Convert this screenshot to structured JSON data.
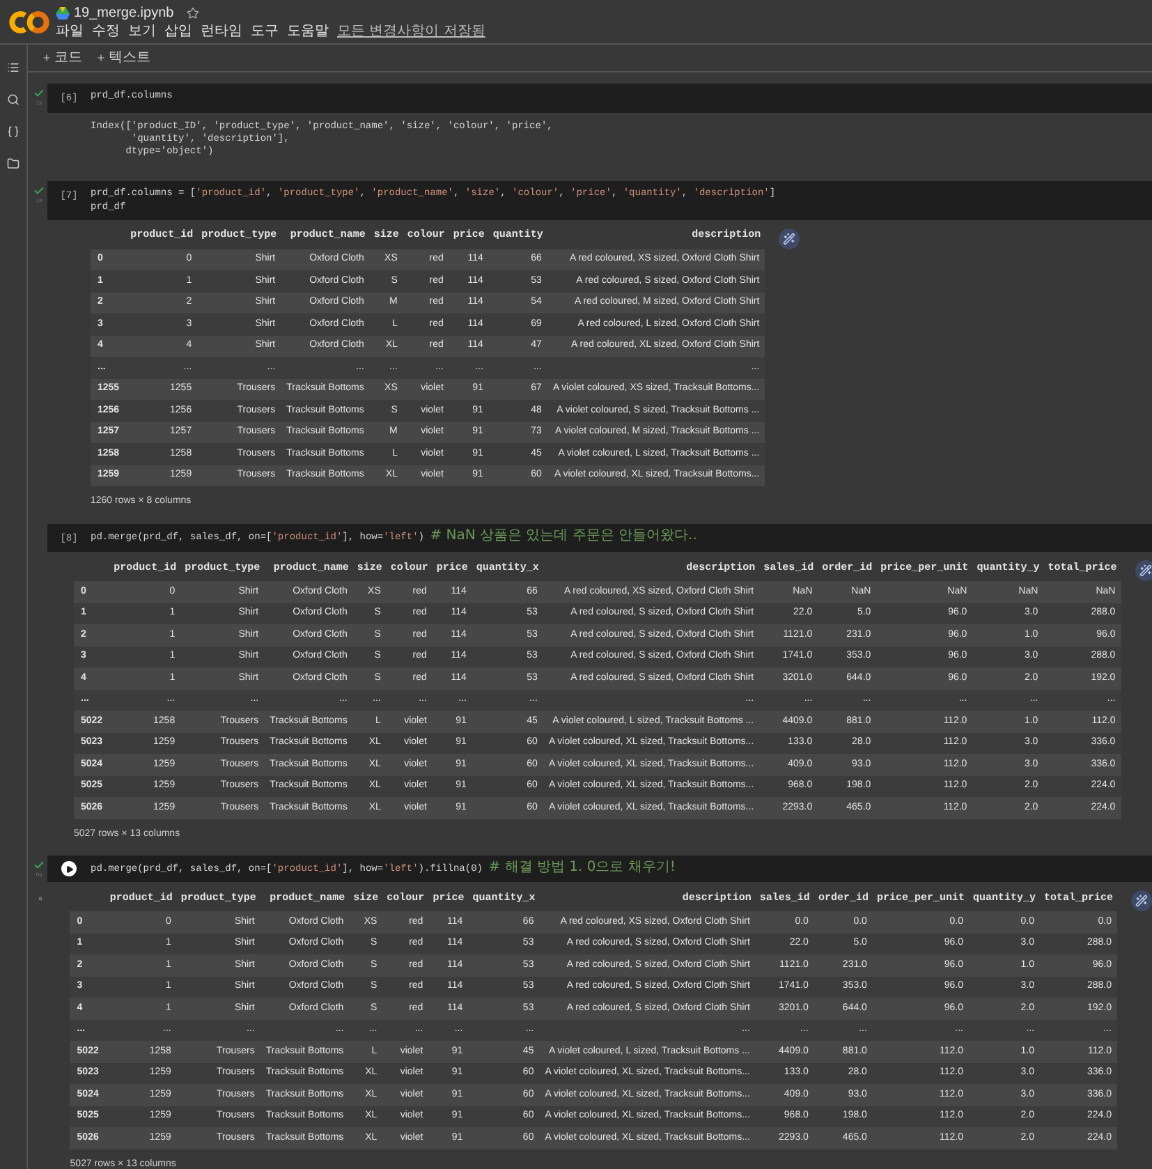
{
  "notebook": {
    "title": "19_merge.ipynb",
    "menu": [
      "파일",
      "수정",
      "보기",
      "삽입",
      "런타임",
      "도구",
      "도움말"
    ],
    "save_status": "모든 변경사항이 저장됨"
  },
  "toolbar": [
    "코드",
    "텍스트"
  ],
  "cells": [
    {
      "count": "[6]",
      "executed": true,
      "time": "1s",
      "focused": false,
      "code": [
        [
          {
            "text": "prd_df.columns",
            "kind": "plain"
          }
        ]
      ],
      "output": {
        "kind": "text",
        "lines": [
          "Index(['product_ID', 'product_type', 'product_name', 'size', 'colour', 'price',",
          "       'quantity', 'description'],",
          "      dtype='object')"
        ]
      }
    },
    {
      "count": "[7]",
      "executed": true,
      "time": "1s",
      "focused": false,
      "code": [
        [
          {
            "text": "prd_df.columns = [",
            "kind": "plain"
          },
          {
            "text": "'product_id'",
            "kind": "string"
          },
          {
            "text": ", ",
            "kind": "plain"
          },
          {
            "text": "'product_type'",
            "kind": "string"
          },
          {
            "text": ", ",
            "kind": "plain"
          },
          {
            "text": "'product_name'",
            "kind": "string"
          },
          {
            "text": ", ",
            "kind": "plain"
          },
          {
            "text": "'size'",
            "kind": "string"
          },
          {
            "text": ", ",
            "kind": "plain"
          },
          {
            "text": "'colour'",
            "kind": "string"
          },
          {
            "text": ", ",
            "kind": "plain"
          },
          {
            "text": "'price'",
            "kind": "string"
          },
          {
            "text": ", ",
            "kind": "plain"
          },
          {
            "text": "'quantity'",
            "kind": "string"
          },
          {
            "text": ", ",
            "kind": "plain"
          },
          {
            "text": "'description'",
            "kind": "string"
          },
          {
            "text": "]",
            "kind": "plain"
          }
        ],
        [
          {
            "text": "prd_df",
            "kind": "plain"
          }
        ]
      ],
      "output": {
        "kind": "table",
        "columns": [
          "",
          "product_id",
          "product_type",
          "product_name",
          "size",
          "colour",
          "price",
          "quantity",
          "description"
        ],
        "rows": [
          [
            "0",
            "0",
            "Shirt",
            "Oxford Cloth",
            "XS",
            "red",
            "114",
            "66",
            "A red coloured, XS sized, Oxford Cloth Shirt"
          ],
          [
            "1",
            "1",
            "Shirt",
            "Oxford Cloth",
            "S",
            "red",
            "114",
            "53",
            "A red coloured, S sized, Oxford Cloth Shirt"
          ],
          [
            "2",
            "2",
            "Shirt",
            "Oxford Cloth",
            "M",
            "red",
            "114",
            "54",
            "A red coloured, M sized, Oxford Cloth Shirt"
          ],
          [
            "3",
            "3",
            "Shirt",
            "Oxford Cloth",
            "L",
            "red",
            "114",
            "69",
            "A red coloured, L sized, Oxford Cloth Shirt"
          ],
          [
            "4",
            "4",
            "Shirt",
            "Oxford Cloth",
            "XL",
            "red",
            "114",
            "47",
            "A red coloured, XL sized, Oxford Cloth Shirt"
          ],
          [
            "...",
            "...",
            "...",
            "...",
            "...",
            "...",
            "...",
            "...",
            "..."
          ],
          [
            "1255",
            "1255",
            "Trousers",
            "Tracksuit Bottoms",
            "XS",
            "violet",
            "91",
            "67",
            "A violet coloured, XS sized, Tracksuit Bottoms..."
          ],
          [
            "1256",
            "1256",
            "Trousers",
            "Tracksuit Bottoms",
            "S",
            "violet",
            "91",
            "48",
            "A violet coloured, S sized, Tracksuit Bottoms ..."
          ],
          [
            "1257",
            "1257",
            "Trousers",
            "Tracksuit Bottoms",
            "M",
            "violet",
            "91",
            "73",
            "A violet coloured, M sized, Tracksuit Bottoms ..."
          ],
          [
            "1258",
            "1258",
            "Trousers",
            "Tracksuit Bottoms",
            "L",
            "violet",
            "91",
            "45",
            "A violet coloured, L sized, Tracksuit Bottoms ..."
          ],
          [
            "1259",
            "1259",
            "Trousers",
            "Tracksuit Bottoms",
            "XL",
            "violet",
            "91",
            "60",
            "A violet coloured, XL sized, Tracksuit Bottoms..."
          ]
        ],
        "footer": "1260 rows × 8 columns"
      }
    },
    {
      "count": "[8]",
      "executed": false,
      "focused": false,
      "code": [
        [
          {
            "text": "pd.merge(prd_df, sales_df, on=[",
            "kind": "plain"
          },
          {
            "text": "'product_id'",
            "kind": "string"
          },
          {
            "text": "], how=",
            "kind": "plain"
          },
          {
            "text": "'left'",
            "kind": "string"
          },
          {
            "text": ") ",
            "kind": "plain"
          },
          {
            "text": "# NaN 상품은 있는데 주문은 안들어왔다..",
            "kind": "comment"
          }
        ]
      ],
      "output": {
        "kind": "table",
        "columns": [
          "",
          "product_id",
          "product_type",
          "product_name",
          "size",
          "colour",
          "price",
          "quantity_x",
          "description",
          "sales_id",
          "order_id",
          "price_per_unit",
          "quantity_y",
          "total_price"
        ],
        "rows": [
          [
            "0",
            "0",
            "Shirt",
            "Oxford Cloth",
            "XS",
            "red",
            "114",
            "66",
            "A red coloured, XS sized, Oxford Cloth Shirt",
            "NaN",
            "NaN",
            "NaN",
            "NaN",
            "NaN"
          ],
          [
            "1",
            "1",
            "Shirt",
            "Oxford Cloth",
            "S",
            "red",
            "114",
            "53",
            "A red coloured, S sized, Oxford Cloth Shirt",
            "22.0",
            "5.0",
            "96.0",
            "3.0",
            "288.0"
          ],
          [
            "2",
            "1",
            "Shirt",
            "Oxford Cloth",
            "S",
            "red",
            "114",
            "53",
            "A red coloured, S sized, Oxford Cloth Shirt",
            "1121.0",
            "231.0",
            "96.0",
            "1.0",
            "96.0"
          ],
          [
            "3",
            "1",
            "Shirt",
            "Oxford Cloth",
            "S",
            "red",
            "114",
            "53",
            "A red coloured, S sized, Oxford Cloth Shirt",
            "1741.0",
            "353.0",
            "96.0",
            "3.0",
            "288.0"
          ],
          [
            "4",
            "1",
            "Shirt",
            "Oxford Cloth",
            "S",
            "red",
            "114",
            "53",
            "A red coloured, S sized, Oxford Cloth Shirt",
            "3201.0",
            "644.0",
            "96.0",
            "2.0",
            "192.0"
          ],
          [
            "...",
            "...",
            "...",
            "...",
            "...",
            "...",
            "...",
            "...",
            "...",
            "...",
            "...",
            "...",
            "...",
            "..."
          ],
          [
            "5022",
            "1258",
            "Trousers",
            "Tracksuit Bottoms",
            "L",
            "violet",
            "91",
            "45",
            "A violet coloured, L sized, Tracksuit Bottoms ...",
            "4409.0",
            "881.0",
            "112.0",
            "1.0",
            "112.0"
          ],
          [
            "5023",
            "1259",
            "Trousers",
            "Tracksuit Bottoms",
            "XL",
            "violet",
            "91",
            "60",
            "A violet coloured, XL sized, Tracksuit Bottoms...",
            "133.0",
            "28.0",
            "112.0",
            "3.0",
            "336.0"
          ],
          [
            "5024",
            "1259",
            "Trousers",
            "Tracksuit Bottoms",
            "XL",
            "violet",
            "91",
            "60",
            "A violet coloured, XL sized, Tracksuit Bottoms...",
            "409.0",
            "93.0",
            "112.0",
            "3.0",
            "336.0"
          ],
          [
            "5025",
            "1259",
            "Trousers",
            "Tracksuit Bottoms",
            "XL",
            "violet",
            "91",
            "60",
            "A violet coloured, XL sized, Tracksuit Bottoms...",
            "968.0",
            "198.0",
            "112.0",
            "2.0",
            "224.0"
          ],
          [
            "5026",
            "1259",
            "Trousers",
            "Tracksuit Bottoms",
            "XL",
            "violet",
            "91",
            "60",
            "A violet coloured, XL sized, Tracksuit Bottoms...",
            "2293.0",
            "465.0",
            "112.0",
            "2.0",
            "224.0"
          ]
        ],
        "footer": "5027 rows × 13 columns"
      }
    },
    {
      "executed": true,
      "time": "0s",
      "focused": true,
      "code": [
        [
          {
            "text": "pd.merge(prd_df, sales_df, on=[",
            "kind": "plain"
          },
          {
            "text": "'product_id'",
            "kind": "string"
          },
          {
            "text": "], how=",
            "kind": "plain"
          },
          {
            "text": "'left'",
            "kind": "string"
          },
          {
            "text": ").fillna(0) ",
            "kind": "plain"
          },
          {
            "text": "# 해결 방법 1. 0으로 채우기!",
            "kind": "comment"
          }
        ]
      ],
      "output": {
        "kind": "table",
        "columns": [
          "",
          "product_id",
          "product_type",
          "product_name",
          "size",
          "colour",
          "price",
          "quantity_x",
          "description",
          "sales_id",
          "order_id",
          "price_per_unit",
          "quantity_y",
          "total_price"
        ],
        "rows": [
          [
            "0",
            "0",
            "Shirt",
            "Oxford Cloth",
            "XS",
            "red",
            "114",
            "66",
            "A red coloured, XS sized, Oxford Cloth Shirt",
            "0.0",
            "0.0",
            "0.0",
            "0.0",
            "0.0"
          ],
          [
            "1",
            "1",
            "Shirt",
            "Oxford Cloth",
            "S",
            "red",
            "114",
            "53",
            "A red coloured, S sized, Oxford Cloth Shirt",
            "22.0",
            "5.0",
            "96.0",
            "3.0",
            "288.0"
          ],
          [
            "2",
            "1",
            "Shirt",
            "Oxford Cloth",
            "S",
            "red",
            "114",
            "53",
            "A red coloured, S sized, Oxford Cloth Shirt",
            "1121.0",
            "231.0",
            "96.0",
            "1.0",
            "96.0"
          ],
          [
            "3",
            "1",
            "Shirt",
            "Oxford Cloth",
            "S",
            "red",
            "114",
            "53",
            "A red coloured, S sized, Oxford Cloth Shirt",
            "1741.0",
            "353.0",
            "96.0",
            "3.0",
            "288.0"
          ],
          [
            "4",
            "1",
            "Shirt",
            "Oxford Cloth",
            "S",
            "red",
            "114",
            "53",
            "A red coloured, S sized, Oxford Cloth Shirt",
            "3201.0",
            "644.0",
            "96.0",
            "2.0",
            "192.0"
          ],
          [
            "...",
            "...",
            "...",
            "...",
            "...",
            "...",
            "...",
            "...",
            "...",
            "...",
            "...",
            "...",
            "...",
            "..."
          ],
          [
            "5022",
            "1258",
            "Trousers",
            "Tracksuit Bottoms",
            "L",
            "violet",
            "91",
            "45",
            "A violet coloured, L sized, Tracksuit Bottoms ...",
            "4409.0",
            "881.0",
            "112.0",
            "1.0",
            "112.0"
          ],
          [
            "5023",
            "1259",
            "Trousers",
            "Tracksuit Bottoms",
            "XL",
            "violet",
            "91",
            "60",
            "A violet coloured, XL sized, Tracksuit Bottoms...",
            "133.0",
            "28.0",
            "112.0",
            "3.0",
            "336.0"
          ],
          [
            "5024",
            "1259",
            "Trousers",
            "Tracksuit Bottoms",
            "XL",
            "violet",
            "91",
            "60",
            "A violet coloured, XL sized, Tracksuit Bottoms...",
            "409.0",
            "93.0",
            "112.0",
            "3.0",
            "336.0"
          ],
          [
            "5025",
            "1259",
            "Trousers",
            "Tracksuit Bottoms",
            "XL",
            "violet",
            "91",
            "60",
            "A violet coloured, XL sized, Tracksuit Bottoms...",
            "968.0",
            "198.0",
            "112.0",
            "2.0",
            "224.0"
          ],
          [
            "5026",
            "1259",
            "Trousers",
            "Tracksuit Bottoms",
            "XL",
            "violet",
            "91",
            "60",
            "A violet coloured, XL sized, Tracksuit Bottoms...",
            "2293.0",
            "465.0",
            "112.0",
            "2.0",
            "224.0"
          ]
        ],
        "footer": "5027 rows × 13 columns"
      }
    }
  ]
}
